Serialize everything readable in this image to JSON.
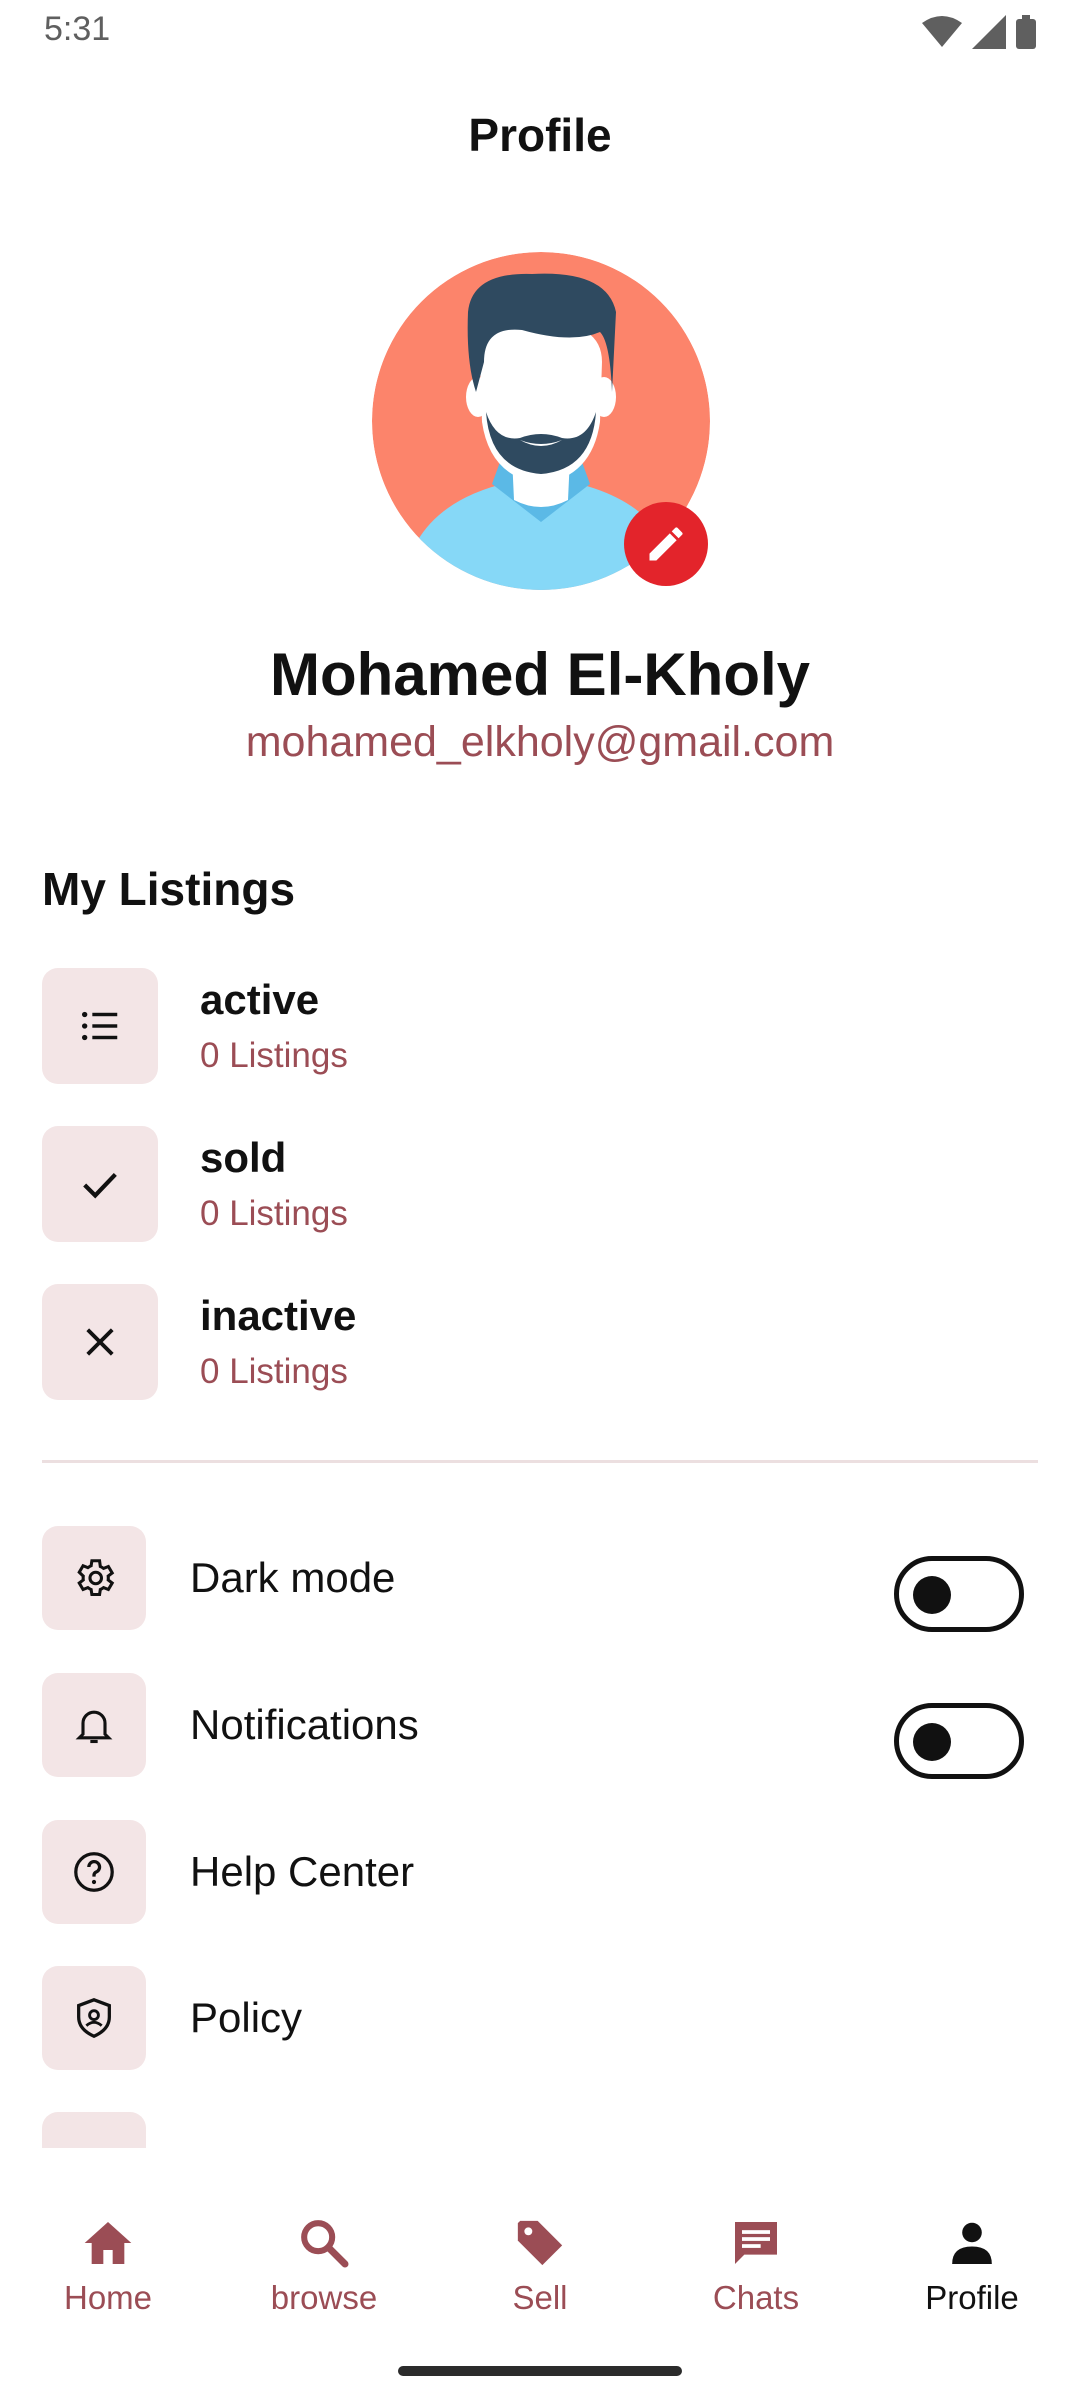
{
  "status_bar": {
    "time": "5:31"
  },
  "header": {
    "title": "Profile"
  },
  "profile": {
    "name": "Mohamed El-Kholy",
    "email": "mohamed_elkholy@gmail.com"
  },
  "listings": {
    "title": "My Listings",
    "items": [
      {
        "label": "active",
        "count": "0  Listings",
        "icon": "list-icon"
      },
      {
        "label": "sold",
        "count": "0  Listings",
        "icon": "check-icon"
      },
      {
        "label": "inactive",
        "count": "0  Listings",
        "icon": "close-icon"
      }
    ]
  },
  "settings": {
    "items": [
      {
        "label": "Dark mode",
        "icon": "gear-icon",
        "toggle": false
      },
      {
        "label": "Notifications",
        "icon": "bell-icon",
        "toggle": false
      },
      {
        "label": "Help Center",
        "icon": "help-icon"
      },
      {
        "label": "Policy",
        "icon": "shield-icon"
      }
    ]
  },
  "nav": {
    "items": [
      {
        "label": "Home",
        "icon": "home-icon",
        "active": false
      },
      {
        "label": "browse",
        "icon": "search-icon",
        "active": false
      },
      {
        "label": "Sell",
        "icon": "tag-icon",
        "active": false
      },
      {
        "label": "Chats",
        "icon": "chat-icon",
        "active": false
      },
      {
        "label": "Profile",
        "icon": "person-icon",
        "active": true
      }
    ]
  },
  "colors": {
    "accent": "#9b4d55",
    "icon_bg": "#f3e5e6",
    "edit_badge": "#e3242b",
    "avatar_bg": "#fc846b"
  }
}
